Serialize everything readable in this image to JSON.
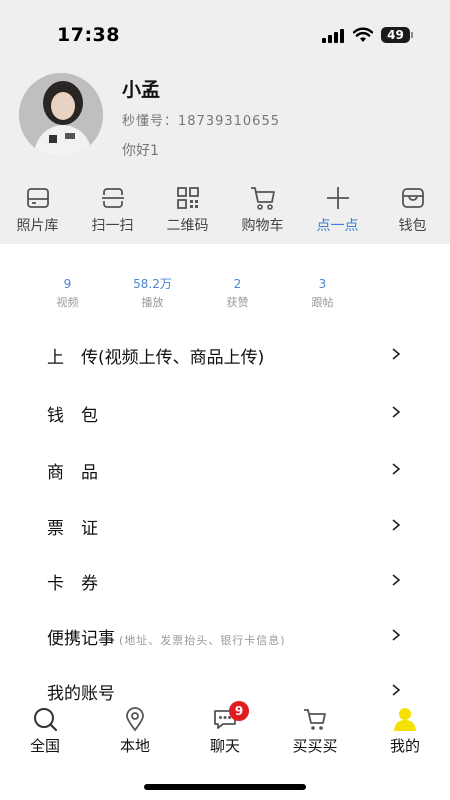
{
  "status_bar": {
    "time": "17:38",
    "battery": "49"
  },
  "profile": {
    "name": "小孟",
    "id_label": "秒懂号：18739310655",
    "bio": "你好1"
  },
  "shortcuts": [
    {
      "label": "照片库",
      "icon": "photo-library-icon"
    },
    {
      "label": "扫一扫",
      "icon": "scan-icon"
    },
    {
      "label": "二维码",
      "icon": "qr-code-icon"
    },
    {
      "label": "购物车",
      "icon": "shopping-cart-icon"
    },
    {
      "label": "点一点",
      "icon": "plus-icon",
      "active": true
    },
    {
      "label": "钱包",
      "icon": "wallet-icon"
    }
  ],
  "stats": [
    {
      "value": "9",
      "label": "视频"
    },
    {
      "value": "58.2万",
      "label": "播放"
    },
    {
      "value": "2",
      "label": "获赞"
    },
    {
      "value": "3",
      "label": "跟帖"
    }
  ],
  "menu": [
    {
      "label": "上　传(视频上传、商品上传)"
    },
    {
      "label": "钱　包"
    },
    {
      "label": "商　品"
    },
    {
      "label": "票　证"
    },
    {
      "label": "卡　券"
    },
    {
      "label": "便携记事",
      "note": "(地址、发票抬头、银行卡信息)"
    },
    {
      "label": "我的账号"
    }
  ],
  "tabs": [
    {
      "label": "全国",
      "icon": "search-icon"
    },
    {
      "label": "本地",
      "icon": "location-pin-icon"
    },
    {
      "label": "聊天",
      "icon": "chat-icon",
      "badge": "9"
    },
    {
      "label": "买买买",
      "icon": "cart-icon"
    },
    {
      "label": "我的",
      "icon": "person-icon",
      "active": true
    }
  ],
  "colors": {
    "accent_blue": "#3d7fd6",
    "active_tab_yellow": "#f5e100",
    "badge_red": "#e11b22",
    "header_gray": "#efefef"
  }
}
